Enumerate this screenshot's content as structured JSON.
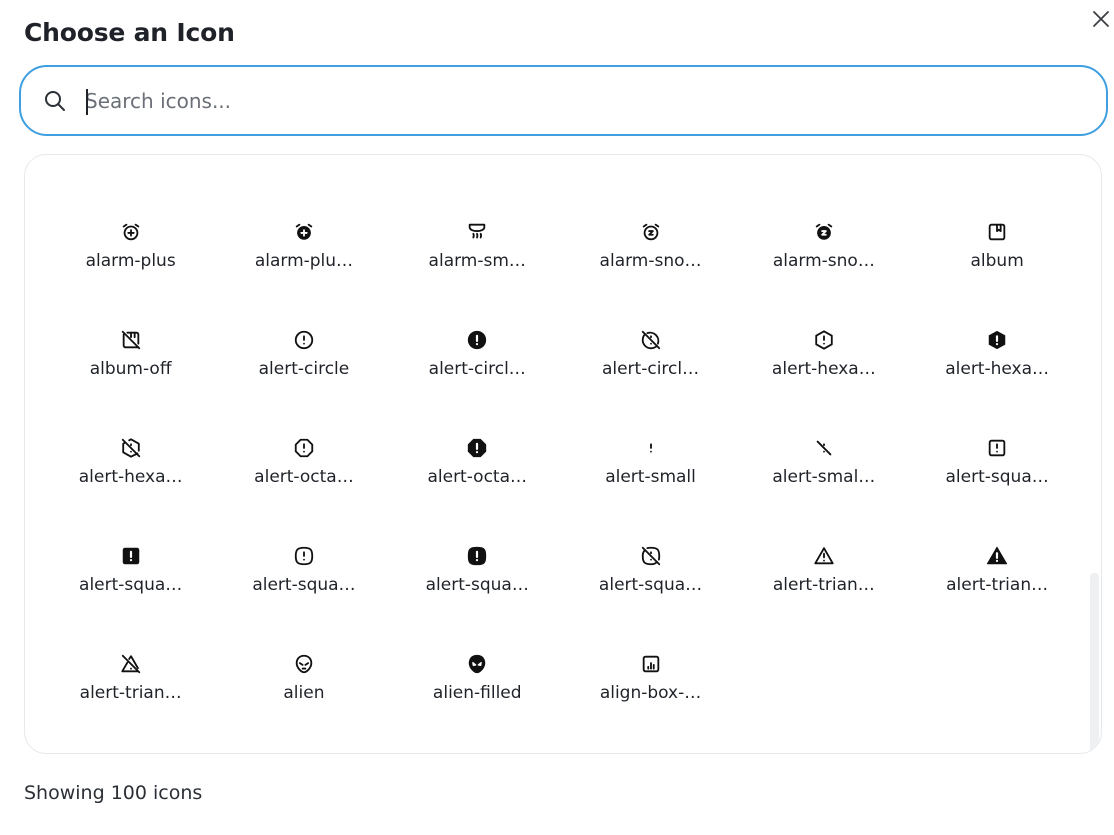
{
  "dialog": {
    "title": "Choose an Icon"
  },
  "search": {
    "placeholder": "Search icons...",
    "value": ""
  },
  "icons": [
    {
      "label": "alarm-plus",
      "icon": "alarm-plus-icon"
    },
    {
      "label": "alarm-plu…",
      "icon": "alarm-plus-filled-icon"
    },
    {
      "label": "alarm-sm…",
      "icon": "alarm-smoke-icon"
    },
    {
      "label": "alarm-sno…",
      "icon": "alarm-snooze-icon"
    },
    {
      "label": "alarm-sno…",
      "icon": "alarm-snooze-filled-icon"
    },
    {
      "label": "album",
      "icon": "album-icon"
    },
    {
      "label": "album-off",
      "icon": "album-off-icon"
    },
    {
      "label": "alert-circle",
      "icon": "alert-circle-icon"
    },
    {
      "label": "alert-circl…",
      "icon": "alert-circle-filled-icon"
    },
    {
      "label": "alert-circl…",
      "icon": "alert-circle-off-icon"
    },
    {
      "label": "alert-hexa…",
      "icon": "alert-hexagon-icon"
    },
    {
      "label": "alert-hexa…",
      "icon": "alert-hexagon-filled-icon"
    },
    {
      "label": "alert-hexa…",
      "icon": "alert-hexagon-off-icon"
    },
    {
      "label": "alert-octa…",
      "icon": "alert-octagon-icon"
    },
    {
      "label": "alert-octa…",
      "icon": "alert-octagon-filled-icon"
    },
    {
      "label": "alert-small",
      "icon": "alert-small-icon"
    },
    {
      "label": "alert-smal…",
      "icon": "alert-small-off-icon"
    },
    {
      "label": "alert-squa…",
      "icon": "alert-square-icon"
    },
    {
      "label": "alert-squa…",
      "icon": "alert-square-filled-icon"
    },
    {
      "label": "alert-squa…",
      "icon": "alert-square-rounded-icon"
    },
    {
      "label": "alert-squa…",
      "icon": "alert-square-rounded-filled-icon"
    },
    {
      "label": "alert-squa…",
      "icon": "alert-square-rounded-off-icon"
    },
    {
      "label": "alert-trian…",
      "icon": "alert-triangle-icon"
    },
    {
      "label": "alert-trian…",
      "icon": "alert-triangle-filled-icon"
    },
    {
      "label": "alert-trian…",
      "icon": "alert-triangle-off-icon"
    },
    {
      "label": "alien",
      "icon": "alien-icon"
    },
    {
      "label": "alien-filled",
      "icon": "alien-filled-icon"
    },
    {
      "label": "align-box-…",
      "icon": "align-box-bottom-center-icon"
    }
  ],
  "footer": {
    "count_text": "Showing 100 icons"
  },
  "colors": {
    "accent": "#3f9fe0",
    "text": "#1f2329",
    "border": "#e6e8eb"
  }
}
